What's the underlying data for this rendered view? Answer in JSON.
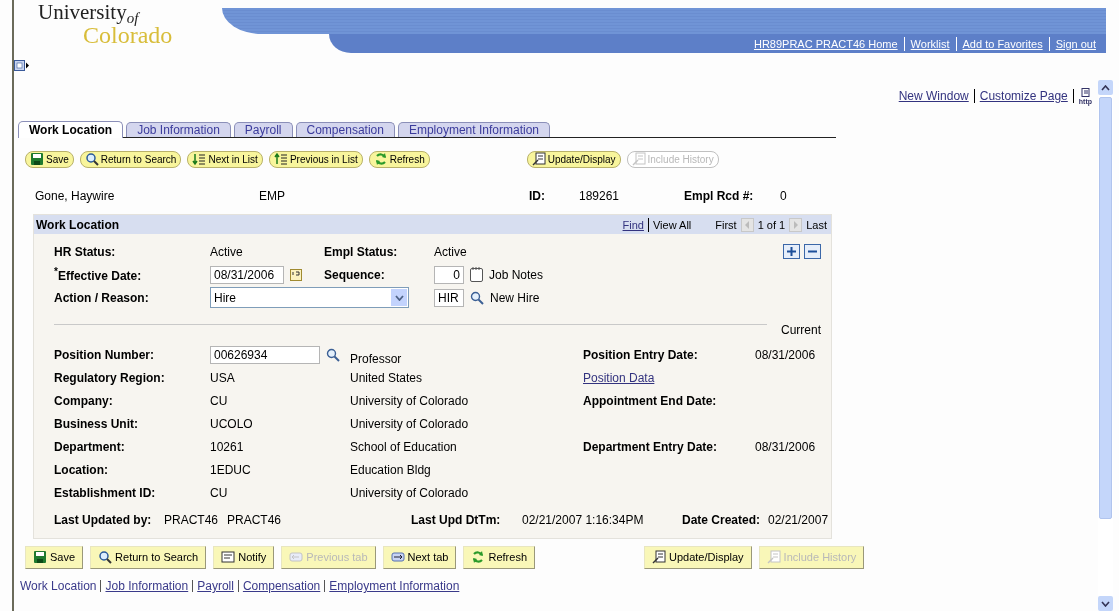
{
  "header": {
    "logo": {
      "line1": "University",
      "suffix": "of",
      "line2": "Colorado"
    },
    "nav_links": [
      "HR89PRAC PRACT46 Home",
      "Worklist",
      "Add to Favorites",
      "Sign out"
    ]
  },
  "page_links": [
    "New Window",
    "Customize Page"
  ],
  "http_label": "http",
  "tabs": [
    {
      "label": "Work Location",
      "selected": true
    },
    {
      "label": "Job Information",
      "selected": false
    },
    {
      "label": "Payroll",
      "selected": false
    },
    {
      "label": "Compensation",
      "selected": false
    },
    {
      "label": "Employment Information",
      "selected": false
    }
  ],
  "top_toolbar": {
    "left": [
      {
        "label": "Save",
        "kind": "save",
        "disabled": false
      },
      {
        "label": "Return to Search",
        "kind": "search",
        "disabled": false
      },
      {
        "label": "Next in List",
        "kind": "next",
        "disabled": false
      },
      {
        "label": "Previous in List",
        "kind": "previous",
        "disabled": false
      },
      {
        "label": "Refresh",
        "kind": "refresh",
        "disabled": false
      }
    ],
    "right": [
      {
        "label": "Update/Display",
        "kind": "update",
        "disabled": false
      },
      {
        "label": "Include History",
        "kind": "history",
        "disabled": true
      }
    ]
  },
  "employee": {
    "name": "Gone, Haywire",
    "type": "EMP",
    "id_label": "ID:",
    "id": "189261",
    "rcd_label": "Empl Rcd #:",
    "rcd": "0"
  },
  "panel": {
    "title": "Work Location",
    "find": "Find",
    "view_all": "View All",
    "first": "First",
    "range": "1 of 1",
    "last": "Last",
    "hr_status": {
      "label": "HR Status:",
      "value": "Active"
    },
    "empl_status": {
      "label": "Empl Status:",
      "value": "Active"
    },
    "effective_date": {
      "label": "$^{*}$Effective Date:",
      "value": "08/31/2006"
    },
    "sequence": {
      "label": "Sequence:",
      "value": "0"
    },
    "job_notes": "Job Notes",
    "action": {
      "label": "Action / Reason:",
      "value": "Hire"
    },
    "reason": {
      "value": "HIR",
      "description": "New Hire"
    },
    "current": "Current",
    "rows": [
      {
        "label": "Position Number:",
        "value": "00626934",
        "kind": "field",
        "description": "Professor",
        "right_label": "Position Entry Date:",
        "right_value": "08/31/2006"
      },
      {
        "label": "Regulatory Region:",
        "value": "USA",
        "kind": "text",
        "description": "United States",
        "right_link": "Position Data"
      },
      {
        "label": "Company:",
        "value": "CU",
        "kind": "text",
        "description": "University of Colorado",
        "right_label": "Appointment End Date:"
      },
      {
        "label": "Business Unit:",
        "value": "UCOLO",
        "kind": "text",
        "description": "University of Colorado"
      },
      {
        "label": "Department:",
        "value": "10261",
        "kind": "text",
        "description": "School of Education",
        "right_label": "Department Entry Date:",
        "right_value": "08/31/2006"
      },
      {
        "label": "Location:",
        "value": "1EDUC",
        "kind": "text",
        "description": "Education Bldg"
      },
      {
        "label": "Establishment ID:",
        "value": "CU",
        "kind": "text",
        "description": "University of Colorado"
      }
    ],
    "footer": {
      "updated_label": "Last Updated by:",
      "updated_by": "PRACT46",
      "updated_name": "PRACT46",
      "upd_label": "Last Upd DtTm:",
      "upd_value": "02/21/2007 1:16:34PM",
      "created_label": "Date Created:",
      "created_value": "02/21/2007"
    }
  },
  "bottom_toolbar": {
    "left": [
      {
        "label": "Save",
        "kind": "save",
        "disabled": false
      },
      {
        "label": "Return to Search",
        "kind": "search",
        "disabled": false
      },
      {
        "label": "Notify",
        "kind": "notify",
        "disabled": false
      },
      {
        "label": "Previous tab",
        "kind": "prevtab",
        "disabled": true
      },
      {
        "label": "Next tab",
        "kind": "nexttab",
        "disabled": false
      },
      {
        "label": "Refresh",
        "kind": "refresh",
        "disabled": false
      }
    ],
    "right": [
      {
        "label": "Update/Display",
        "kind": "update",
        "disabled": false
      },
      {
        "label": "Include History",
        "kind": "history",
        "disabled": true
      }
    ]
  },
  "bottom_links": [
    {
      "label": "Work Location",
      "selected": true
    },
    {
      "label": "Job Information",
      "selected": false
    },
    {
      "label": "Payroll",
      "selected": false
    },
    {
      "label": "Compensation",
      "selected": false
    },
    {
      "label": "Employment Information",
      "selected": false
    }
  ]
}
